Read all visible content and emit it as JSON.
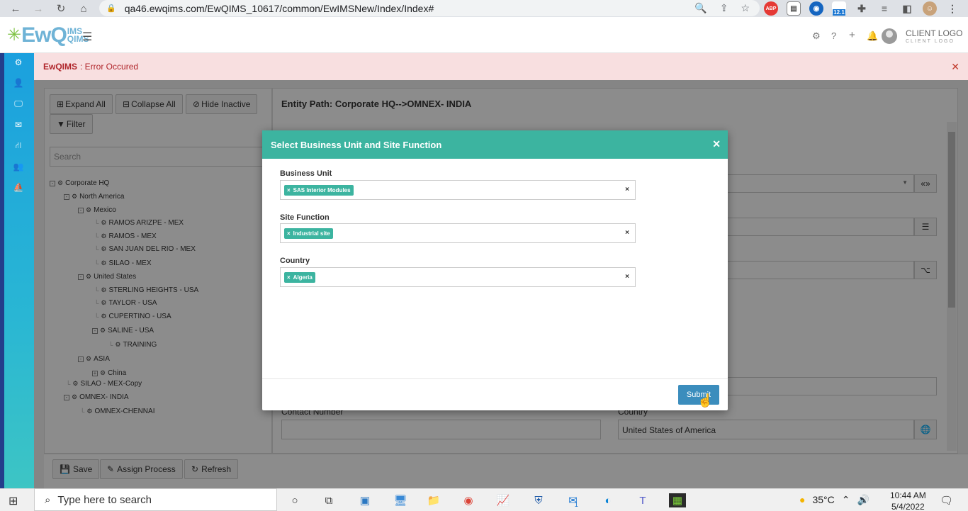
{
  "browser": {
    "url": "qa46.ewqims.com/EwQIMS_10617/common/EwIMSNew/Index/Index#",
    "ext_badge": "12.1",
    "abp": "ABP"
  },
  "header": {
    "logo_main": "EwQ",
    "logo_ims": "IMS",
    "logo_qims": "QIMS",
    "client_logo": "CLIENT LOGO",
    "client_logo_sub": "CLIENT LOGO"
  },
  "error": {
    "app": "EwQIMS",
    "message": ": Error Occured"
  },
  "toolbar": {
    "expand_all": "Expand All",
    "collapse_all": "Collapse All",
    "hide_inactive": "Hide Inactive",
    "filter": "Filter",
    "search_placeholder": "Search"
  },
  "tree": [
    {
      "label": "Corporate HQ"
    },
    {
      "label": "North America"
    },
    {
      "label": "Mexico"
    },
    {
      "label": "RAMOS ARIZPE - MEX"
    },
    {
      "label": "RAMOS - MEX"
    },
    {
      "label": "SAN JUAN DEL RIO - MEX"
    },
    {
      "label": "SILAO - MEX"
    },
    {
      "label": "United States"
    },
    {
      "label": "STERLING HEIGHTS - USA"
    },
    {
      "label": "TAYLOR - USA"
    },
    {
      "label": "CUPERTINO - USA"
    },
    {
      "label": "SALINE - USA"
    },
    {
      "label": "TRAINING"
    },
    {
      "label": "ASIA"
    },
    {
      "label": "China"
    },
    {
      "label": "SILAO - MEX-Copy"
    },
    {
      "label": "OMNEX- INDIA"
    },
    {
      "label": "OMNEX-CHENNAI"
    }
  ],
  "right": {
    "entity_path": "Entity Path: Corporate HQ-->OMNEX- INDIA",
    "contact_label": "Contact Number",
    "country_label": "Country",
    "country_value": "United States of America"
  },
  "bottom": {
    "save": "Save",
    "assign": "Assign Process",
    "refresh": "Refresh"
  },
  "modal": {
    "title": "Select Business Unit and Site Function",
    "business_unit_label": "Business Unit",
    "business_unit_value": "SAS Interior Modules",
    "site_function_label": "Site Function",
    "site_function_value": "Industrial site",
    "country_label": "Country",
    "country_value": "Algeria",
    "submit": "Submit"
  },
  "taskbar": {
    "search_placeholder": "Type here to search",
    "temperature": "35°C",
    "time": "10:44 AM",
    "date": "5/4/2022",
    "mail_badge": "1"
  }
}
